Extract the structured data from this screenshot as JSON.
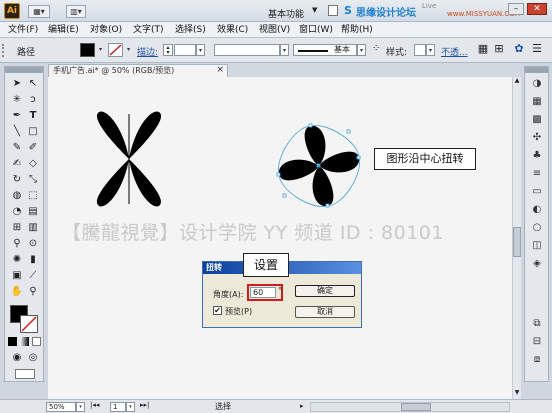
{
  "titlebar": {
    "app_logo": "Ai",
    "workspace": "基本功能",
    "brand": "思缘设计论坛",
    "site": "www.MISSYUAN.COM",
    "live": "Live",
    "layout_icon": "layout-icon"
  },
  "menu": [
    "文件(F)",
    "编辑(E)",
    "对象(O)",
    "文字(T)",
    "选择(S)",
    "效果(C)",
    "视图(V)",
    "窗口(W)",
    "帮助(H)"
  ],
  "control": {
    "selection_label": "路径",
    "stroke_label": "描边:",
    "style_label": "样式:",
    "brush_label": "基本",
    "opacity_label": "不透..."
  },
  "document": {
    "tab_title": "手机广告.ai* @ 50% (RGB/预览)",
    "close_icon": "×"
  },
  "canvas": {
    "watermark": "【騰龍視覺】设计学院  YY 频道 ID : 80101",
    "callout_twist": "图形沿中心扭转",
    "callout_setting": "设置"
  },
  "dialog": {
    "title": "扭转",
    "angle_label": "角度(A):",
    "angle_value": "60",
    "degree_symbol": "°",
    "preview_label": "预览(P)",
    "preview_checked": true,
    "ok_label": "确定",
    "cancel_label": "取消"
  },
  "status": {
    "zoom": "50%",
    "page": "1",
    "tool": "选择"
  },
  "colors": {
    "fill": "#000000",
    "accent": "#3d6fb5",
    "highlight": "#d11a1a"
  }
}
